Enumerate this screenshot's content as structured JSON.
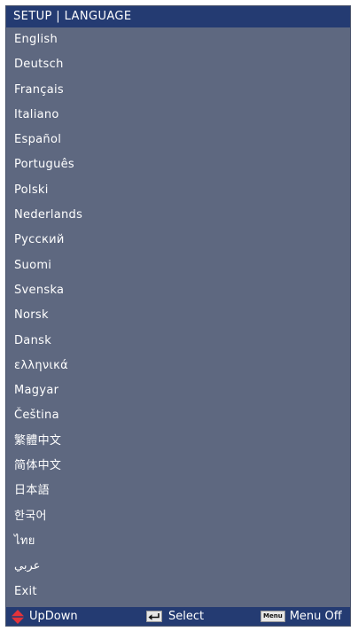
{
  "header": {
    "title": "SETUP | LANGUAGE"
  },
  "languages": [
    "English",
    "Deutsch",
    "Français",
    "Italiano",
    "Español",
    "Português",
    "Polski",
    "Nederlands",
    "Русский",
    "Suomi",
    "Svenska",
    "Norsk",
    "Dansk",
    "ελληνικά",
    "Magyar",
    "Čeština",
    "繁體中文",
    "简体中文",
    "日本語",
    "한국어",
    "ไทย",
    "عربي"
  ],
  "exit_label": "Exit",
  "footer": {
    "updown_label": "UpDown",
    "select_label": "Select",
    "menu_key_label": "Menu",
    "menuoff_label": "Menu Off"
  },
  "colors": {
    "header_bg": "#243b72",
    "panel_bg": "#5e6880",
    "updown_icon": "#e2333a"
  },
  "icons": {
    "updown": "updown-arrows-icon",
    "select": "enter-key-icon",
    "menu": "menu-key-icon"
  }
}
